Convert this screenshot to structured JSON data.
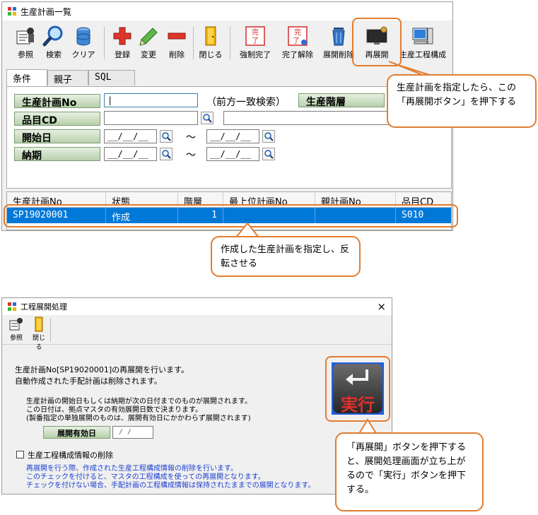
{
  "window1": {
    "title": "生産計画一覧",
    "toolbar": [
      {
        "label": "参照",
        "icon": "reference-icon"
      },
      {
        "label": "検索",
        "icon": "magnifier-icon"
      },
      {
        "label": "クリア",
        "icon": "clear-icon"
      },
      {
        "label": "登録",
        "icon": "plus-icon"
      },
      {
        "label": "変更",
        "icon": "pencil-icon"
      },
      {
        "label": "削除",
        "icon": "minus-icon"
      },
      {
        "label": "閉じる",
        "icon": "door-icon"
      },
      {
        "label": "強制完了",
        "icon": "complete-stamp-icon"
      },
      {
        "label": "完了解除",
        "icon": "complete-cancel-icon"
      },
      {
        "label": "展開削除",
        "icon": "trash-icon"
      },
      {
        "label": "再展開",
        "icon": "redeploy-monitor-icon"
      },
      {
        "label": "生産工程構成",
        "icon": "computer-icon"
      }
    ],
    "tabs": [
      "条件",
      "親子",
      "SQL"
    ],
    "form": {
      "plan_no_label": "生産計画No",
      "plan_no_value": "|",
      "prefix_search": "（前方一致検索）",
      "hierarchy_label": "生産階層",
      "item_cd_label": "品目CD",
      "item_cd_value": "",
      "start_date_label": "開始日",
      "start_date_from": "__/__/__",
      "start_date_to": "__/__/__",
      "due_date_label": "納期",
      "due_date_from": "__/__/__",
      "due_date_to": "__/__/__",
      "tilde": "～"
    },
    "grid": {
      "columns": [
        "生産計画No",
        "状態",
        "階層",
        "最上位計画No",
        "親計画No",
        "品目CD"
      ],
      "rows": [
        {
          "plan_no": "SP19020001",
          "status": "作成",
          "level": "1",
          "top_plan_no": "",
          "parent_plan_no": "",
          "item_cd": "S010"
        }
      ]
    }
  },
  "callouts": {
    "top": "生産計画を指定したら、この「再展開ボタン」を押下する",
    "middle": "作成した生産計画を指定し、反転させる",
    "bottom": "「再展開」ボタンを押下すると、展開処理画面が立ち上がるので「実行」ボタンを押下する。"
  },
  "window2": {
    "title": "工程展開処理",
    "close": "×",
    "toolbar": [
      {
        "label": "参照",
        "icon": "reference-icon"
      },
      {
        "label": "閉じる",
        "icon": "door-icon"
      }
    ],
    "msg1": "生産計画No[SP19020001]の再展開を行います。",
    "msg2": "自動作成された手配計画は削除されます。",
    "note1": "生産計画の開始日もしくは納期が次の日付までのものが展開されます。",
    "note2": "この日付は、拠点マスタの有効展開日数で決まります。",
    "note3": "(製番指定の単独展開のものは、展開有効日にかかわらず展開されます)",
    "valid_date_label": "展開有効日",
    "valid_date_value": "/ /",
    "delete_check_label": "生産工程構成情報の削除",
    "blue1": "再展開を行う際、作成された生産工程構成情報の削除を行います。",
    "blue2": "このチェックを付けると、マスタの工程構成を使っての再展開となります。",
    "blue3": "チェックを付けない場合、手配計画の工程構成情報は保持されたままでの展開となります。",
    "exec_label": "実行"
  },
  "colors": {
    "accent": "#e27c2e",
    "selection": "#0078d7",
    "label_green": "#b7d0aa",
    "exec_text": "#e0302a",
    "note_blue": "#1c3fd0"
  }
}
